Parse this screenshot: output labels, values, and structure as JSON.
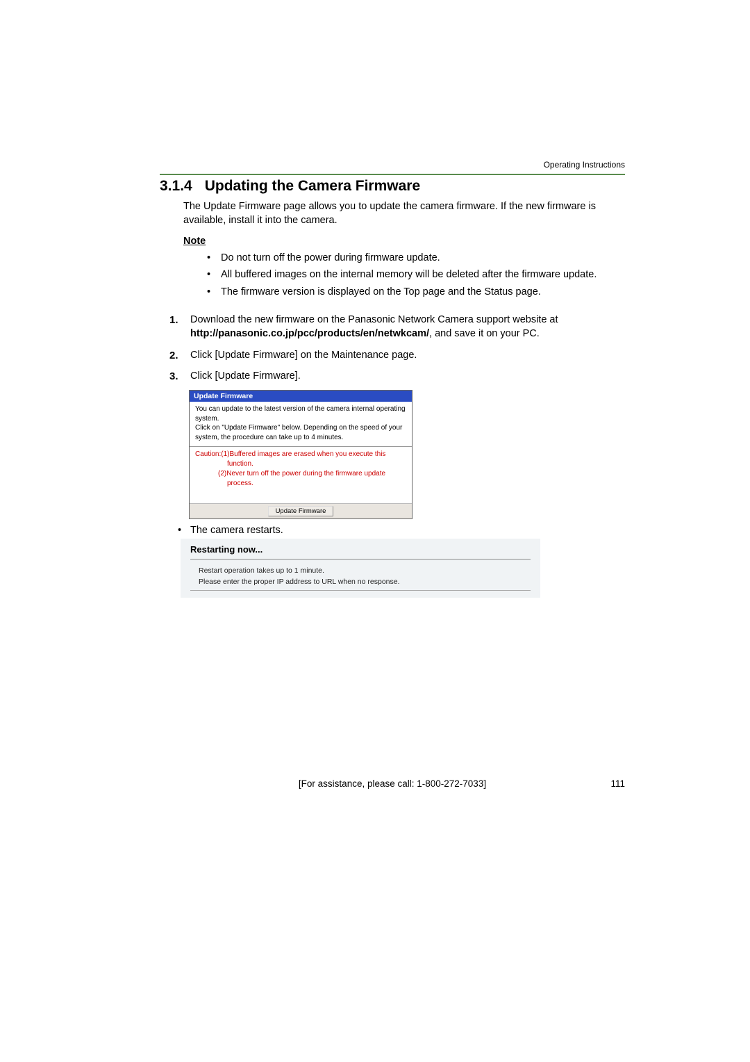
{
  "header": {
    "label": "Operating Instructions"
  },
  "section": {
    "number": "3.1.4",
    "title": "Updating the Camera Firmware",
    "intro": "The Update Firmware page allows you to update the camera firmware. If the new firmware is available, install it into the camera."
  },
  "note": {
    "heading": "Note",
    "items": [
      "Do not turn off the power during firmware update.",
      "All buffered images on the internal memory will be deleted after the firmware update.",
      "The firmware version is displayed on the Top page and the Status page."
    ]
  },
  "steps": {
    "s1_pre": "Download the new firmware on the Panasonic Network Camera support website at ",
    "s1_url": "http://panasonic.co.jp/pcc/products/en/netwkcam/",
    "s1_post": ", and save it on your PC.",
    "s2": "Click [Update Firmware] on the Maintenance page.",
    "s3": "Click [Update Firmware]."
  },
  "firmware_panel": {
    "title": "Update Firmware",
    "body": "You can update to the latest version of the camera internal operating system.\nClick on \"Update Firmware\" below. Depending on the speed of your system, the procedure can take up to 4 minutes.",
    "caution1": "Caution:(1)Buffered images are erased when you execute this function.",
    "caution2": "(2)Never turn off the power during the firmware update process.",
    "button": "Update Firmware"
  },
  "restart_bullet": "The camera restarts.",
  "restart_panel": {
    "title": "Restarting now...",
    "line1": "Restart operation takes up to 1 minute.",
    "line2": "Please enter the proper IP address to URL when no response."
  },
  "footer": {
    "assist": "[For assistance, please call: 1-800-272-7033]",
    "page": "111"
  }
}
